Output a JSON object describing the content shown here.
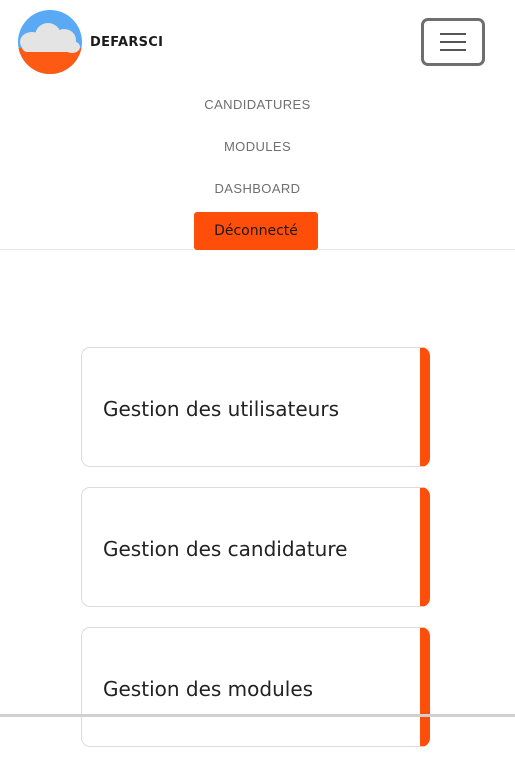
{
  "brand": {
    "name": "DEFARSCI",
    "colors": {
      "sky": "#5aa9f5",
      "ground": "#ff5a14",
      "cloud": "#e4e4e4"
    }
  },
  "nav": {
    "menu_toggle_icon": "hamburger-icon",
    "links": [
      "CANDIDATURES",
      "MODULES",
      "DASHBOARD"
    ],
    "logout_label": "Déconnecté"
  },
  "cards": [
    "Gestion des utilisateurs",
    "Gestion des candidature",
    "Gestion des modules"
  ],
  "colors": {
    "accent": "#ff4d0a",
    "nav_text": "#6f6f6f",
    "border": "#dcdcdc"
  }
}
